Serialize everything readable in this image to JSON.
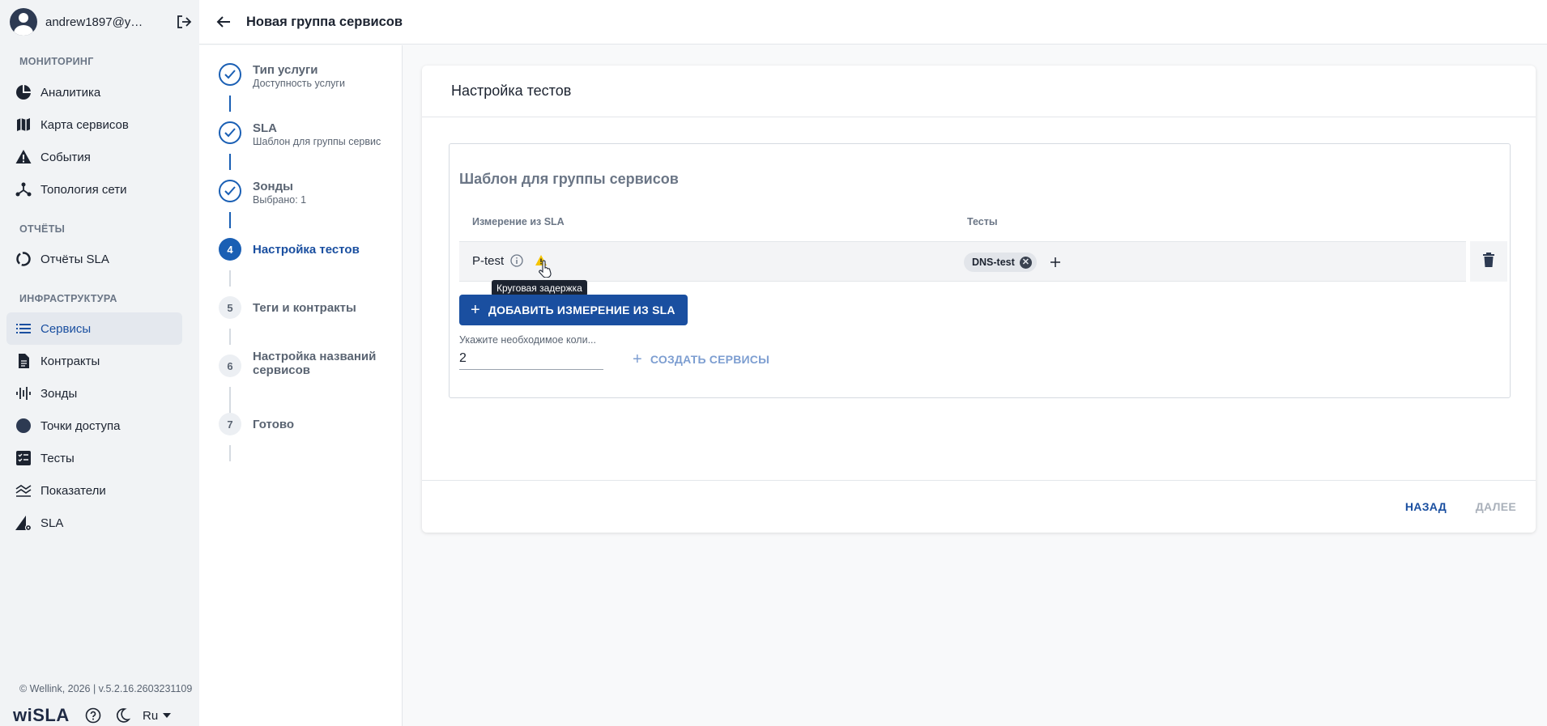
{
  "user": {
    "name": "andrew1897@yan..."
  },
  "sidebar": {
    "sections": [
      {
        "title": "МОНИТОРИНГ"
      },
      {
        "title": "ОТЧЁТЫ"
      },
      {
        "title": "ИНФРАСТРУКТУРА"
      }
    ],
    "items": [
      {
        "label": "Аналитика",
        "icon": "analytics-icon"
      },
      {
        "label": "Карта сервисов",
        "icon": "map-icon"
      },
      {
        "label": "События",
        "icon": "warning-icon"
      },
      {
        "label": "Топология сети",
        "icon": "topology-icon"
      },
      {
        "label": "Отчёты SLA",
        "icon": "report-icon"
      },
      {
        "label": "Сервисы",
        "icon": "list-icon",
        "active": true
      },
      {
        "label": "Контракты",
        "icon": "document-icon"
      },
      {
        "label": "Зонды",
        "icon": "probes-icon"
      },
      {
        "label": "Точки доступа",
        "icon": "access-point-icon"
      },
      {
        "label": "Тесты",
        "icon": "tests-icon"
      },
      {
        "label": "Показатели",
        "icon": "metrics-icon"
      },
      {
        "label": "SLA",
        "icon": "sla-icon"
      }
    ]
  },
  "footer": {
    "copyright": "© Wellink, 2026 | v.5.2.16.2603231109",
    "logo": "wiSLA",
    "language": "Ru"
  },
  "header": {
    "title": "Новая группа сервисов"
  },
  "stepper": {
    "steps": [
      {
        "number": "1",
        "title": "Тип услуги",
        "subtitle": "Доступность услуги",
        "state": "done"
      },
      {
        "number": "2",
        "title": "SLA",
        "subtitle": "Шаблон для группы сервис",
        "state": "done"
      },
      {
        "number": "3",
        "title": "Зонды",
        "subtitle": "Выбрано: 1",
        "state": "done"
      },
      {
        "number": "4",
        "title": "Настройка тестов",
        "subtitle": "",
        "state": "current"
      },
      {
        "number": "5",
        "title": "Теги и контракты",
        "subtitle": "",
        "state": "todo"
      },
      {
        "number": "6",
        "title": "Настройка названий сервисов",
        "subtitle": "",
        "state": "todo"
      },
      {
        "number": "7",
        "title": "Готово",
        "subtitle": "",
        "state": "todo"
      }
    ]
  },
  "main": {
    "card_title": "Настройка тестов",
    "template": {
      "title": "Шаблон для группы сервисов",
      "columns": [
        "Измерение из SLA",
        "Тесты"
      ],
      "rows": [
        {
          "measurement": "P-test",
          "tests": [
            "DNS-test"
          ]
        }
      ],
      "tooltip": "Круговая задержка",
      "add_button": "ДОБАВИТЬ ИЗМЕРЕНИЕ ИЗ SLA",
      "quantity_label": "Укажите необходимое коли...",
      "quantity_value": "2",
      "create_button": "СОЗДАТЬ СЕРВИСЫ"
    },
    "back_button": "НАЗАД",
    "next_button": "ДАЛЕЕ"
  },
  "colors": {
    "accent": "#1a4fa0",
    "step_active": "#1a5fb4",
    "warning": "#f5c400",
    "disabled": "#a9b0ba"
  }
}
